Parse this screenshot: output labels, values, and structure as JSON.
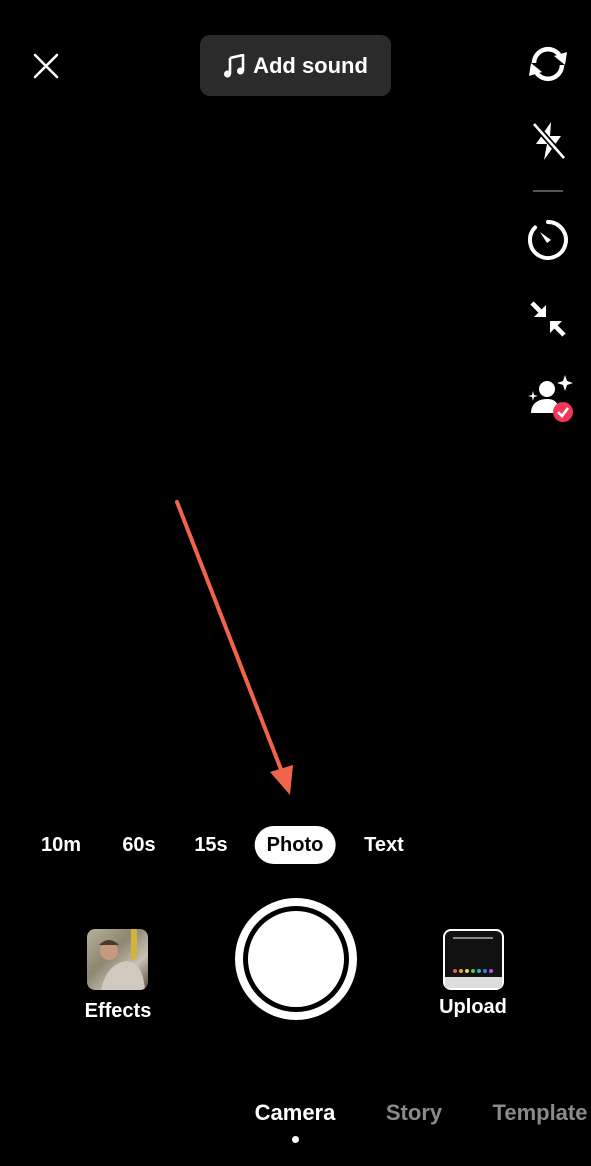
{
  "top_bar": {
    "add_sound_label": "Add sound"
  },
  "side_tools": [
    "flip-camera",
    "flash-off",
    "timer",
    "collapse",
    "beauty-enabled"
  ],
  "modes": [
    {
      "label": "10m",
      "active": false
    },
    {
      "label": "60s",
      "active": false
    },
    {
      "label": "15s",
      "active": false
    },
    {
      "label": "Photo",
      "active": true
    },
    {
      "label": "Text",
      "active": false
    }
  ],
  "capture": {
    "effects_label": "Effects",
    "upload_label": "Upload"
  },
  "bottom_tabs": [
    {
      "label": "Camera",
      "active": true
    },
    {
      "label": "Story",
      "active": false
    },
    {
      "label": "Template",
      "active": false
    }
  ],
  "colors": {
    "annotation_arrow": "#f0654a",
    "badge": "#f2375a",
    "inactive_tab": "#8a8a8a"
  }
}
